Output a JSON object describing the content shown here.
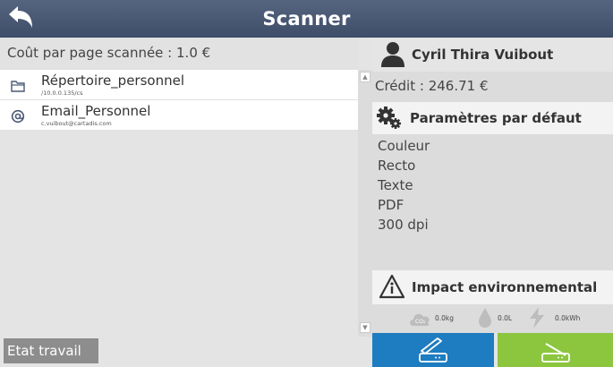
{
  "header": {
    "title": "Scanner",
    "back_icon": "back-arrow-icon"
  },
  "left": {
    "cost_text": "Coût par page scannée : 1.0 €",
    "destinations": [
      {
        "name": "Répertoire_personnel",
        "sub": "/10.0.0.135/cs",
        "icon": "folder-icon"
      },
      {
        "name": "Email_Personnel",
        "sub": "c.vuibout@cartadis.com",
        "icon": "at-sign-icon"
      }
    ],
    "etat_button": "Etat travail"
  },
  "right": {
    "user_name": "Cyril Thira Vuibout",
    "credit": "Crédit : 246.71 €",
    "defaults_title": "Paramètres par défaut",
    "defaults": [
      "Couleur",
      "Recto",
      "Texte",
      "PDF",
      "300 dpi"
    ],
    "env_title": "Impact environnemental",
    "env_values": {
      "co2": "0.0kg",
      "water": "0.0L",
      "energy": "0.0kWh"
    }
  },
  "colors": {
    "header": "#4a5974",
    "scan_button": "#1e7cc0",
    "start_button": "#8cc63f"
  }
}
